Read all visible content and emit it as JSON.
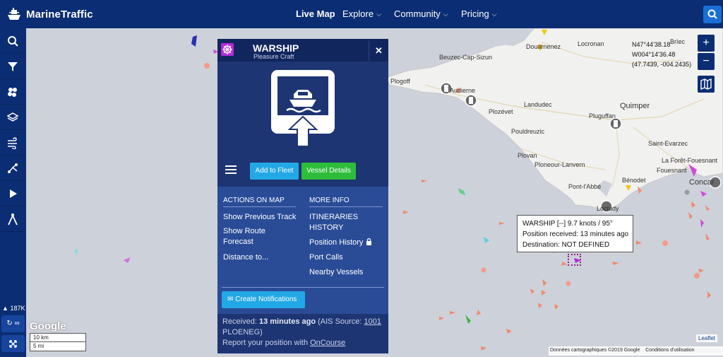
{
  "app": {
    "name": "MarineTraffic"
  },
  "nav": {
    "items": [
      {
        "label": "Live Map",
        "active": true
      },
      {
        "label": "Explore",
        "dropdown": true
      },
      {
        "label": "Community",
        "dropdown": true
      },
      {
        "label": "Pricing",
        "dropdown": true
      }
    ]
  },
  "sidebar": {
    "tools": [
      "search-icon",
      "filter-icon",
      "layers-cluster-icon",
      "stack-layers-icon",
      "wind-icon",
      "route-icon",
      "play-icon",
      "compass-measure-icon"
    ],
    "vessel_count": "187K",
    "infinity_label": "∞"
  },
  "map": {
    "places": [
      {
        "name": "Brìec",
        "size": "small"
      },
      {
        "name": "Douarnenez",
        "size": "small"
      },
      {
        "name": "Locronan",
        "size": "small"
      },
      {
        "name": "Beuzec-Cap-Sizun",
        "size": "small"
      },
      {
        "name": "Plogoff",
        "size": "small"
      },
      {
        "name": "Audierne",
        "size": "small"
      },
      {
        "name": "Landudec",
        "size": "small"
      },
      {
        "name": "Quimper",
        "size": "big"
      },
      {
        "name": "Plozévet",
        "size": "small"
      },
      {
        "name": "Pluguffan",
        "size": "small"
      },
      {
        "name": "Pouldreuzic",
        "size": "small"
      },
      {
        "name": "Plovan",
        "size": "small"
      },
      {
        "name": "Saint-Evarzec",
        "size": "small"
      },
      {
        "name": "La Forêt-Fouesnant",
        "size": "small"
      },
      {
        "name": "Fouesnant",
        "size": "small"
      },
      {
        "name": "Ploneour-Lanvern",
        "size": "small"
      },
      {
        "name": "Bénodet",
        "size": "small"
      },
      {
        "name": "Pont-l'Abbé",
        "size": "small"
      },
      {
        "name": "Concarneau",
        "size": "big"
      },
      {
        "name": "Loctudy",
        "size": "small"
      }
    ],
    "coords": {
      "lat": "N47°44'38.18",
      "lon": "W004°14'36.48",
      "decimal": "(47.7439, -004.2435)"
    },
    "zoom_in": "+",
    "zoom_out": "−",
    "scale_km": "10 km",
    "scale_mi": "5 mi",
    "google": "Google",
    "leaflet": "Leaflet",
    "attribution": "Données cartographiques ©2019 Google",
    "terms": "Conditions d'utilisation"
  },
  "vessel": {
    "name": "WARSHIP",
    "type": "Pleasure Craft",
    "add_fleet": "Add to Fleet",
    "details": "Vessel Details",
    "actions_title": "ACTIONS ON MAP",
    "more_title": "MORE INFO",
    "actions": [
      "Show Previous Track",
      "Show Route Forecast",
      "Distance to..."
    ],
    "more": [
      "ITINERARIES HISTORY",
      "Position History",
      "Port Calls",
      "Nearby Vessels"
    ],
    "create_notifications": "Create Notifications",
    "received_label": "Received:",
    "received_value": "13 minutes ago",
    "ais_label": "(AIS Source:",
    "ais_source_id": "1001",
    "ais_source_name": "PLOENEG)",
    "report_text": "Report your position with",
    "report_link": "OnCourse"
  },
  "tooltip": {
    "line1": "WARSHIP [--] 9.7 knots / 95°",
    "line2": "Position received: 13 minutes ago",
    "line3": "Destination: NOT DEFINED"
  },
  "colors": {
    "nav_bg": "#0b2d73",
    "panel_bg": "#1e3573",
    "fleet_btn": "#23a8e6",
    "details_btn": "#2ebd3b",
    "vessel_flag": "#b32bd6"
  }
}
